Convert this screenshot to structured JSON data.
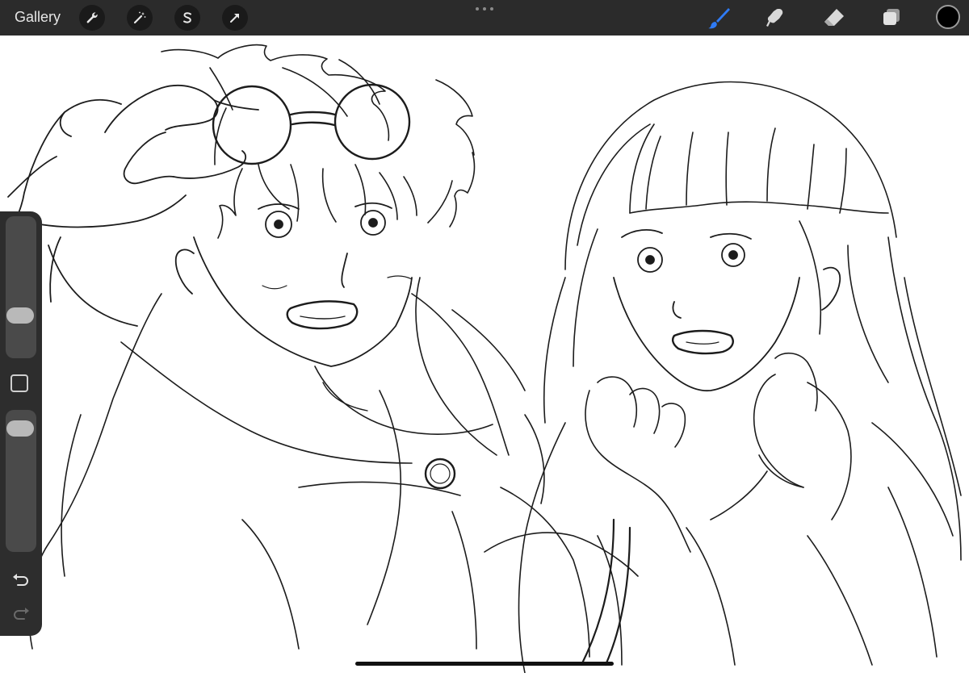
{
  "toolbar": {
    "gallery_label": "Gallery",
    "left_tools": [
      "wrench-icon",
      "magic-wand-icon",
      "selection-s-icon",
      "transform-arrow-icon"
    ],
    "right_tools": [
      "brush-icon",
      "smudge-icon",
      "eraser-icon",
      "layers-icon"
    ],
    "active_tool": "brush-icon",
    "active_tool_color": "#2f7bf5",
    "current_color": "#000000"
  },
  "sidebar": {
    "brush_size_level": 0.26,
    "opacity_level": 0.95
  }
}
